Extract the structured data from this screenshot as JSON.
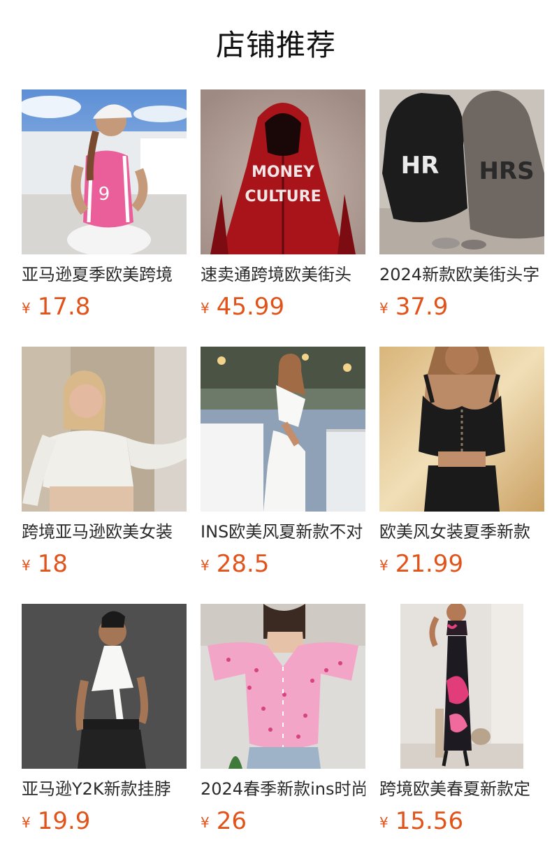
{
  "header": {
    "title": "店铺推荐"
  },
  "currency_symbol": "¥",
  "products": [
    {
      "name": "亚马逊夏季欧美跨境",
      "price": "17.8",
      "image_icon": "pink-tank-top-photo"
    },
    {
      "name": "速卖通跨境欧美街头",
      "price": "45.99",
      "image_icon": "red-hoodie-photo"
    },
    {
      "name": "2024新款欧美街头字",
      "price": "37.9",
      "image_icon": "graphic-hoodies-photo"
    },
    {
      "name": "跨境亚马逊欧美女装",
      "price": "18",
      "image_icon": "white-crop-top-photo"
    },
    {
      "name": "INS欧美风夏新款不对",
      "price": "28.5",
      "image_icon": "white-cutout-dress-photo"
    },
    {
      "name": "欧美风女装夏季新款",
      "price": "21.99",
      "image_icon": "black-corset-top-photo"
    },
    {
      "name": "亚马逊Y2K新款挂脖",
      "price": "19.9",
      "image_icon": "white-halter-top-photo"
    },
    {
      "name": "2024春季新款ins时尚",
      "price": "26",
      "image_icon": "pink-floral-cardigan-photo"
    },
    {
      "name": "跨境欧美春夏新款定",
      "price": "15.56",
      "image_icon": "floral-skirt-set-photo"
    }
  ],
  "colors": {
    "price": "#e2531a",
    "title": "#111111",
    "name": "#2a2a2a"
  }
}
